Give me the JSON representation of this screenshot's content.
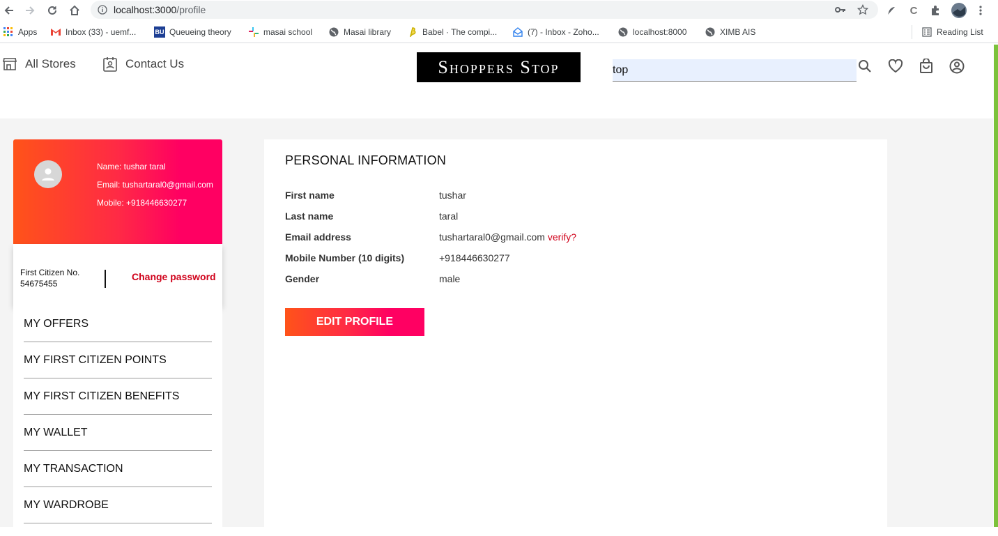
{
  "browser": {
    "url_host": "localhost:3000",
    "url_path": "/profile",
    "bookmarks": [
      {
        "label": "Apps",
        "icon": "apps-grid-icon"
      },
      {
        "label": "Inbox (33) - uemf...",
        "icon": "gmail-icon"
      },
      {
        "label": "Queueing theory",
        "icon": "bu-icon",
        "badge": "BU"
      },
      {
        "label": "masai school",
        "icon": "slack-icon"
      },
      {
        "label": "Masai library",
        "icon": "globe-icon"
      },
      {
        "label": "Babel · The compi...",
        "icon": "babel-icon"
      },
      {
        "label": "(7) - Inbox - Zoho...",
        "icon": "zoho-mail-icon"
      },
      {
        "label": "localhost:8000",
        "icon": "globe-icon"
      },
      {
        "label": "XIMB AIS",
        "icon": "globe-icon"
      }
    ],
    "reading_list": "Reading List"
  },
  "header": {
    "all_stores": "All Stores",
    "contact_us": "Contact Us",
    "logo_text": "Shoppers Stop",
    "search_value": "top"
  },
  "profile": {
    "name_line": "Name: tushar taral",
    "email_line": "Email: tushartaral0@gmail.com",
    "mobile_line": "Mobile: +918446630277",
    "citizen_label": "First Citizen No.",
    "citizen_number": "54675455",
    "change_password": "Change password"
  },
  "menu": [
    "MY OFFERS",
    "MY FIRST CITIZEN POINTS",
    "MY FIRST CITIZEN BENEFITS",
    "MY WALLET",
    "MY TRANSACTION",
    "MY WARDROBE"
  ],
  "personal_info": {
    "title": "PERSONAL INFORMATION",
    "fields": [
      {
        "label": "First name",
        "value": "tushar"
      },
      {
        "label": "Last name",
        "value": "taral"
      },
      {
        "label": "Email address",
        "value": "tushartaral0@gmail.com",
        "action": "verify?"
      },
      {
        "label": "Mobile Number (10 digits)",
        "value": "+918446630277"
      },
      {
        "label": "Gender",
        "value": "male"
      }
    ],
    "edit_button": "EDIT PROFILE"
  },
  "colors": {
    "accent_red": "#d0021b",
    "gradient_start": "#ff5319",
    "gradient_end": "#ff0062"
  }
}
